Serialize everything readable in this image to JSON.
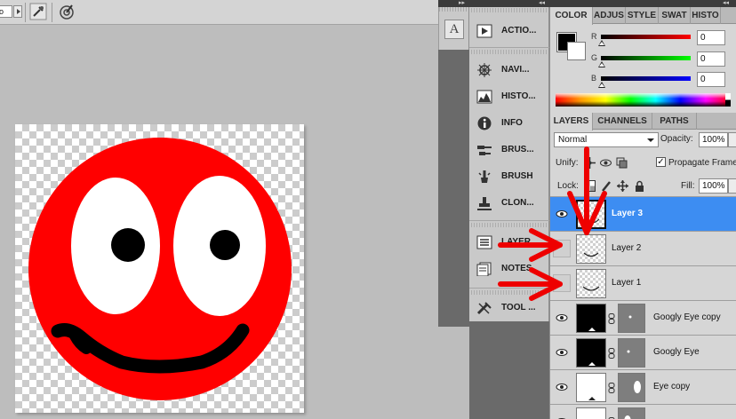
{
  "options_bar": {
    "field_value": "o",
    "tools": [
      "airbrush-toggle-icon",
      "tablet-pressure-icon"
    ]
  },
  "dock_panel_buttons": {
    "character": "A",
    "groups": [
      [
        {
          "label": "ACTIO...",
          "icon": "actions-icon"
        }
      ],
      [
        {
          "label": "NAVI...",
          "icon": "navigator-icon"
        },
        {
          "label": "HISTO...",
          "icon": "histogram-icon"
        },
        {
          "label": "INFO",
          "icon": "info-icon"
        },
        {
          "label": "BRUS...",
          "icon": "brushes-icon"
        },
        {
          "label": "BRUSH",
          "icon": "brush-icon"
        },
        {
          "label": "CLON...",
          "icon": "clone-source-icon"
        }
      ],
      [
        {
          "label": "LAYER...",
          "icon": "layer-comps-icon"
        },
        {
          "label": "NOTES",
          "icon": "notes-icon"
        }
      ],
      [
        {
          "label": "TOOL ...",
          "icon": "tool-presets-icon"
        }
      ]
    ]
  },
  "color_panel": {
    "tabs": [
      "COLOR",
      "ADJUS",
      "STYLE",
      "SWAT",
      "HISTO"
    ],
    "active_tab": "COLOR",
    "foreground": "#000000",
    "background": "#ffffff",
    "channels": [
      {
        "label": "R",
        "value": "0",
        "color": "#cc0000"
      },
      {
        "label": "G",
        "value": "0",
        "color": "#00b000"
      },
      {
        "label": "B",
        "value": "0",
        "color": "#0000cc"
      }
    ]
  },
  "layers_panel": {
    "tabs": [
      "LAYERS",
      "CHANNELS",
      "PATHS"
    ],
    "active_tab": "LAYERS",
    "blend_mode": "Normal",
    "opacity_label": "Opacity:",
    "opacity_value": "100%",
    "unify_label": "Unify:",
    "propagate_label": "Propagate Frame",
    "propagate_checked": "✓",
    "lock_label": "Lock:",
    "fill_label": "Fill:",
    "fill_value": "100%",
    "layers": [
      {
        "name": "Layer 3",
        "visible": true,
        "selected": true,
        "thumb": "transparent",
        "mask": false
      },
      {
        "name": "Layer 2",
        "visible": false,
        "selected": false,
        "thumb": "transparent",
        "mask": false
      },
      {
        "name": "Layer 1",
        "visible": false,
        "selected": false,
        "thumb": "transparent",
        "mask": false
      },
      {
        "name": "Googly Eye copy",
        "visible": true,
        "selected": false,
        "thumb": "black",
        "mask": true
      },
      {
        "name": "Googly Eye",
        "visible": true,
        "selected": false,
        "thumb": "black",
        "mask": true
      },
      {
        "name": "Eye copy",
        "visible": true,
        "selected": false,
        "thumb": "white",
        "mask": true
      },
      {
        "name": "",
        "visible": true,
        "selected": false,
        "thumb": "white",
        "mask": true
      }
    ]
  },
  "colors": {
    "artwork_red": "#ff0000",
    "annotation_red": "#ee0000",
    "selection_blue": "#3d8df2"
  }
}
